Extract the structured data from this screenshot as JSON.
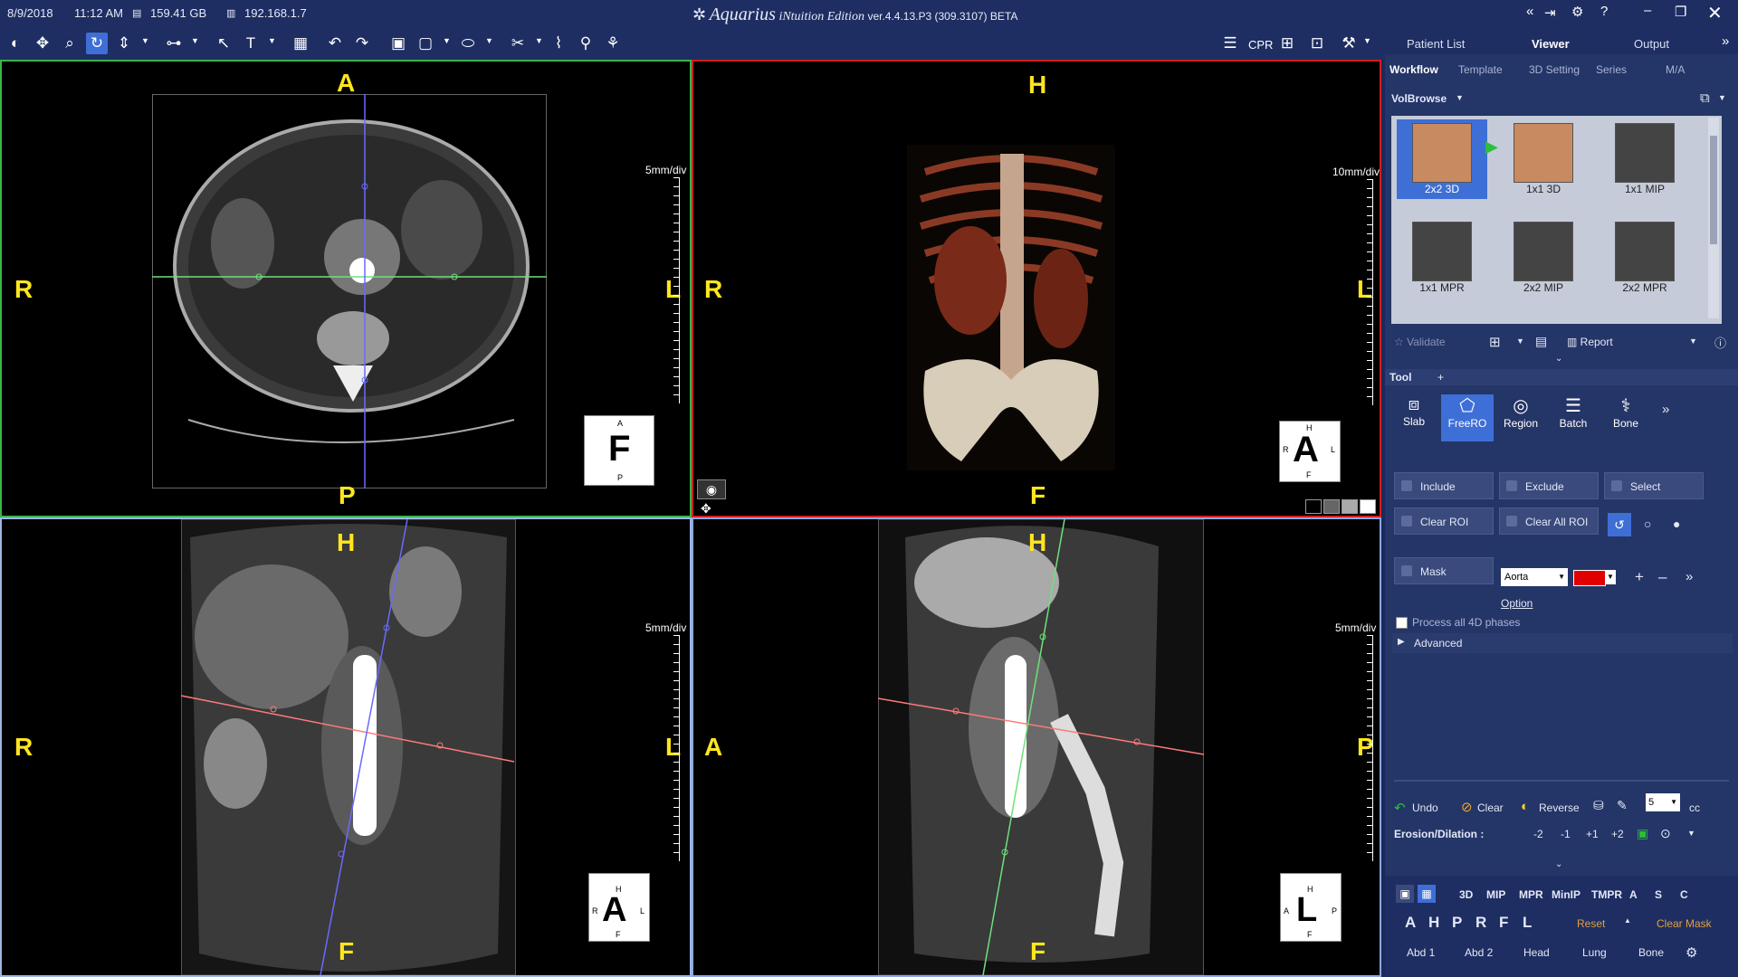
{
  "status": {
    "date": "8/9/2018",
    "time": "11:12 AM",
    "disk": "159.41 GB",
    "ip": "192.168.1.7"
  },
  "app": {
    "brand": "Aquarius",
    "edition": "iNtuition Edition",
    "version": "ver.4.4.13.P3 (309.3107) BETA"
  },
  "toolbar": {
    "cpr_label": "CPR"
  },
  "top_tabs": [
    "Patient List",
    "Viewer",
    "Output"
  ],
  "sub_tabs": [
    "Workflow",
    "Template",
    "3D Setting",
    "Series",
    "M/A"
  ],
  "volbrowse": {
    "label": "VolBrowse"
  },
  "layouts": [
    {
      "label": "2x2 3D",
      "selected": true
    },
    {
      "label": "1x1 3D",
      "selected": false
    },
    {
      "label": "1x1 MIP",
      "selected": false
    },
    {
      "label": "1x1 MPR",
      "selected": false
    },
    {
      "label": "2x2 MIP",
      "selected": false
    },
    {
      "label": "2x2 MPR",
      "selected": false
    }
  ],
  "actions": {
    "validate": "Validate",
    "report": "Report"
  },
  "tool_section": {
    "label": "Tool",
    "plus": "+"
  },
  "tools": [
    "Slab",
    "FreeRO",
    "Region",
    "Batch",
    "Bone"
  ],
  "roi": {
    "include": "Include",
    "exclude": "Exclude",
    "select": "Select",
    "clear_roi": "Clear ROI",
    "clear_all_roi": "Clear All ROI",
    "mask": "Mask",
    "mask_target": "Aorta",
    "mask_color": "#e00000",
    "option": "Option",
    "process_4d": "Process all 4D phases",
    "advanced": "Advanced"
  },
  "edit": {
    "undo": "Undo",
    "clear": "Clear",
    "reverse": "Reverse",
    "size": "5",
    "unit": "cc",
    "erosion_label": "Erosion/Dilation :",
    "steps": [
      "-2",
      "-1",
      "+1",
      "+2"
    ]
  },
  "render_modes": [
    "3D",
    "MIP",
    "MPR",
    "MinIP",
    "TMPR",
    "A",
    "S",
    "C"
  ],
  "orient_buttons": [
    "A",
    "H",
    "P",
    "R",
    "F",
    "L"
  ],
  "reset": "Reset",
  "clear_mask": "Clear Mask",
  "presets": [
    "Abd 1",
    "Abd 2",
    "Head",
    "Lung",
    "Bone"
  ],
  "viewports": {
    "axial": {
      "top": "A",
      "bottom": "P",
      "left": "R",
      "right": "L",
      "scale": "5mm/div",
      "cube": "F",
      "cube_small": [
        "A",
        "P"
      ]
    },
    "volume": {
      "top": "H",
      "bottom": "F",
      "left": "R",
      "right": "L",
      "scale": "10mm/div",
      "cube": "A",
      "cube_small": [
        "H",
        "R",
        "L",
        "F"
      ]
    },
    "coronal": {
      "top": "H",
      "bottom": "F",
      "left": "R",
      "right": "L",
      "scale": "5mm/div",
      "cube": "A",
      "cube_small": [
        "H",
        "R",
        "L",
        "F"
      ]
    },
    "sagittal": {
      "top": "H",
      "bottom": "F",
      "left": "A",
      "right": "P",
      "scale": "5mm/div",
      "cube": "L",
      "cube_small": [
        "H",
        "A",
        "P",
        "F"
      ]
    }
  },
  "colors": {
    "accent": "#3e6fd6",
    "orientation": "#ffe61e",
    "axial_border": "#39b54a",
    "volume_border": "#d21e1e",
    "coronal_border": "#9fb4e6",
    "sagittal_border": "#8ea7e0"
  }
}
